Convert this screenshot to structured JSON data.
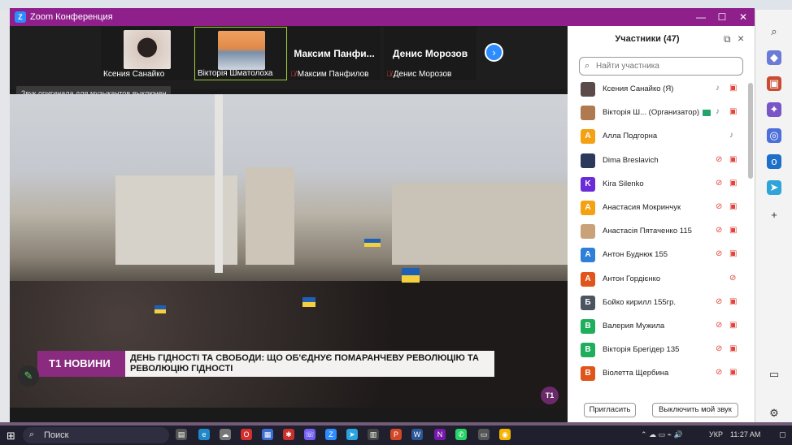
{
  "window": {
    "title": "Zoom Конференция"
  },
  "strip": {
    "tiles": [
      {
        "name": "Ксения Санайко",
        "muted": false,
        "has_video": true
      },
      {
        "name": "Вікторія Шматолоха",
        "muted": false,
        "has_video": true,
        "active": true
      },
      {
        "name": "Максим Панфилов",
        "big_name": "Максим Панфи...",
        "muted": true
      },
      {
        "name": "Денис Морозов",
        "big_name": "Денис Морозов",
        "muted": true
      }
    ],
    "tooltip": "Звук оригинала для музыкантов выключен"
  },
  "video": {
    "ticker_brand": "Т1 НОВИНИ",
    "headline": "ДЕНЬ ГІДНОСТІ ТА СВОБОДИ: ЩО ОБ'ЄДНУЄ ПОМАРАНЧЕВУ РЕВОЛЮЦІЮ ТА РЕВОЛЮЦІЮ ГІДНОСТІ",
    "logo": "T1"
  },
  "participants": {
    "title": "Участники (47)",
    "search_placeholder": "Найти участника",
    "list": [
      {
        "name": "Ксения Санайко (Я)",
        "avatar": "",
        "avatar_color": "#5a4a4a",
        "mic": "on",
        "cam": "off"
      },
      {
        "name": "Вікторія Ш...  (Организатор)",
        "avatar": "",
        "avatar_color": "#b07a50",
        "mic": "on",
        "cam": "off",
        "host": true
      },
      {
        "name": "Алла Подгорна",
        "avatar": "А",
        "avatar_color": "#f4a214",
        "mic": "on",
        "cam": "none"
      },
      {
        "name": "Dima Breslavich",
        "avatar": "",
        "avatar_color": "#2b3a5a",
        "mic": "off",
        "cam": "off"
      },
      {
        "name": "Kira Silenko",
        "avatar": "K",
        "avatar_color": "#6a2bd9",
        "mic": "off",
        "cam": "off"
      },
      {
        "name": "Анастасия Мокринчук",
        "avatar": "А",
        "avatar_color": "#f4a214",
        "mic": "off",
        "cam": "off"
      },
      {
        "name": "Анастасія Пятаченко 115",
        "avatar": "",
        "avatar_color": "#c9a27a",
        "mic": "off",
        "cam": "off"
      },
      {
        "name": "Антон Буднюк 155",
        "avatar": "А",
        "avatar_color": "#2d7fd9",
        "mic": "off",
        "cam": "off"
      },
      {
        "name": "Антон Гордієнко",
        "avatar": "А",
        "avatar_color": "#e0551b",
        "mic": "off",
        "cam": "none"
      },
      {
        "name": "Бойко кирилл 155гр.",
        "avatar": "Б",
        "avatar_color": "#4a5560",
        "mic": "off",
        "cam": "off"
      },
      {
        "name": "Валерия Мужила",
        "avatar": "В",
        "avatar_color": "#1fae5b",
        "mic": "off",
        "cam": "off"
      },
      {
        "name": "Вікторія Брегідер 135",
        "avatar": "В",
        "avatar_color": "#1fae5b",
        "mic": "off",
        "cam": "off"
      },
      {
        "name": "Віолетта Щербина",
        "avatar": "В",
        "avatar_color": "#e0551b",
        "mic": "off",
        "cam": "off"
      }
    ],
    "invite_label": "Пригласить",
    "mute_label": "Выключить мой звук"
  },
  "taskbar": {
    "search_placeholder": "Поиск",
    "lang": "УКР",
    "time": "11:27 AM"
  }
}
